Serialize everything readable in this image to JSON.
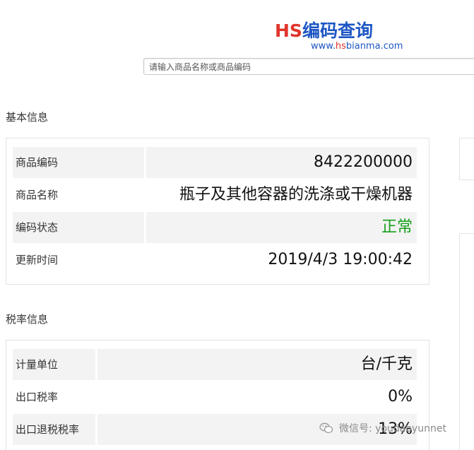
{
  "header": {
    "logo_prefix": "HS",
    "logo_suffix": "编码查询",
    "url_prefix": "www.",
    "url_hs": "hs",
    "url_suffix": "bianma.com"
  },
  "search": {
    "placeholder": "请输入商品名称或商品编码"
  },
  "basic_info": {
    "title": "基本信息",
    "rows": [
      {
        "label": "商品编码",
        "value": "8422200000"
      },
      {
        "label": "商品名称",
        "value": "瓶子及其他容器的洗涤或干燥机器"
      },
      {
        "label": "编码状态",
        "value": "正常"
      },
      {
        "label": "更新时间",
        "value": "2019/4/3 19:00:42"
      }
    ]
  },
  "tax_info": {
    "title": "税率信息",
    "rows": [
      {
        "label": "计量单位",
        "value": "台/千克"
      },
      {
        "label": "出口税率",
        "value": "0%"
      },
      {
        "label": "出口退税税率",
        "value": "13%"
      }
    ]
  },
  "watermark": {
    "text": "微信号: youdaoyunnet",
    "icon": "wechat-icon"
  },
  "colors": {
    "brand_blue": "#1d56c4",
    "brand_red": "#e0352b",
    "status_green": "#16a01a",
    "row_shade": "#f3f3f3"
  }
}
